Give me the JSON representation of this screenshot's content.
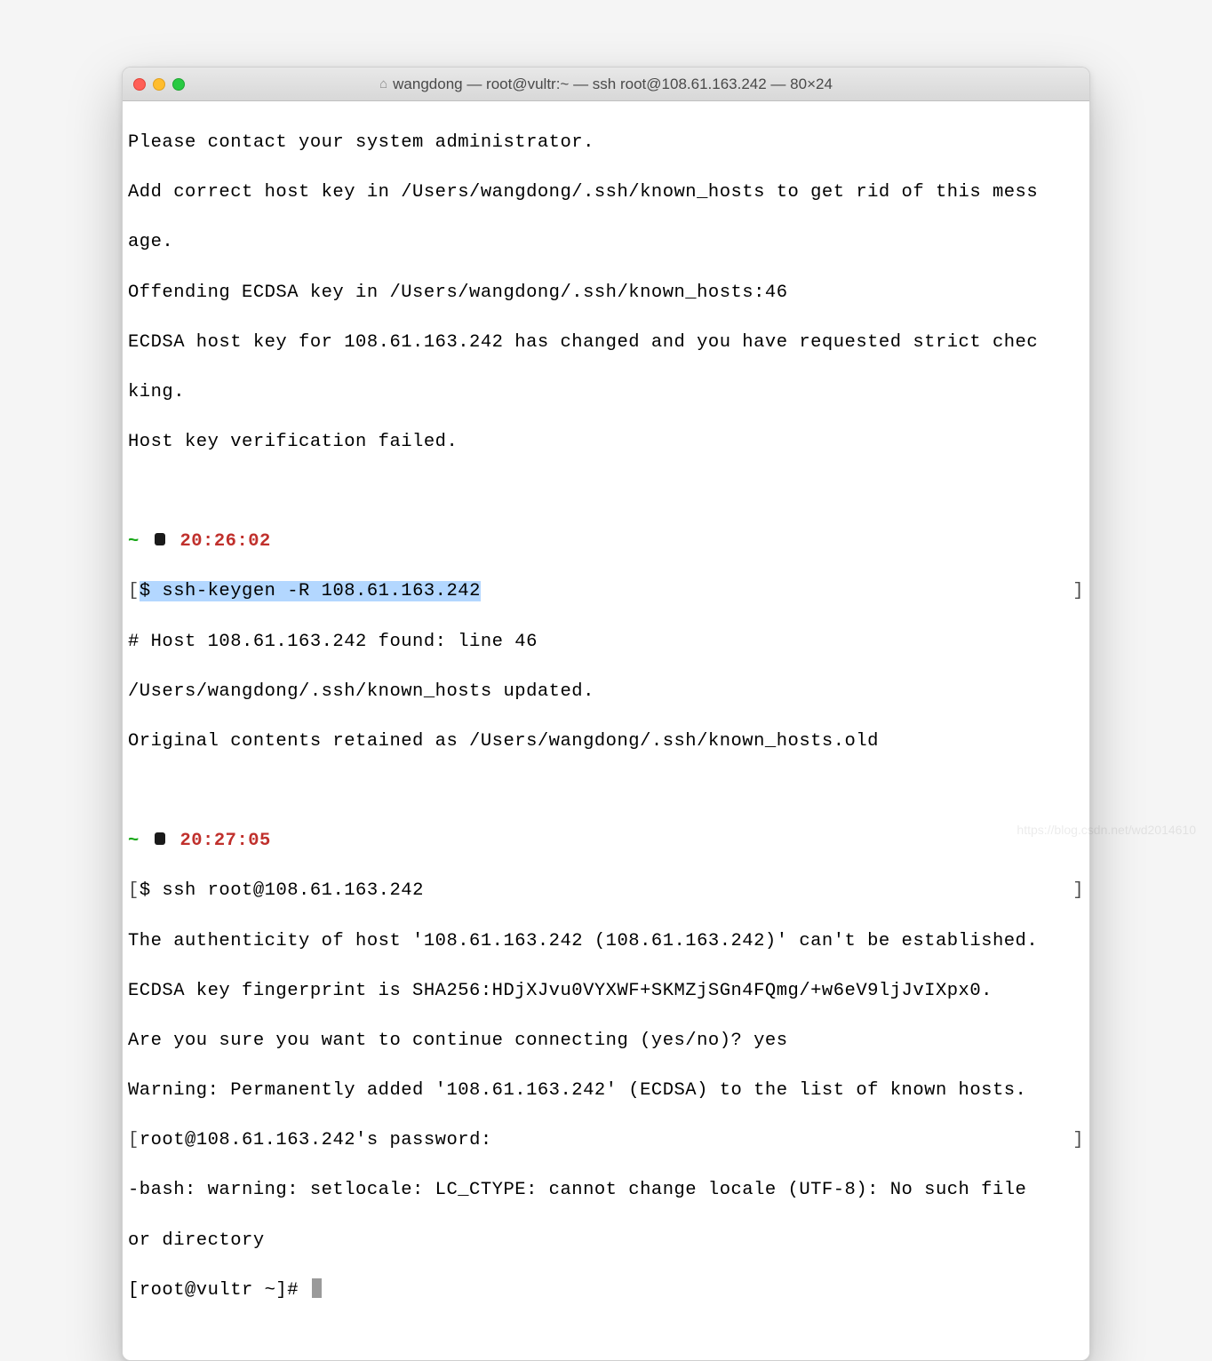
{
  "window": {
    "title": "wangdong — root@vultr:~ — ssh root@108.61.163.242 — 80×24"
  },
  "terminal": {
    "lines": [
      "Please contact your system administrator.",
      "Add correct host key in /Users/wangdong/.ssh/known_hosts to get rid of this mess",
      "age.",
      "Offending ECDSA key in /Users/wangdong/.ssh/known_hosts:46",
      "ECDSA host key for 108.61.163.242 has changed and you have requested strict chec",
      "king.",
      "Host key verification failed."
    ],
    "prompt1": {
      "path": "~",
      "time": "20:26:02",
      "command": "ssh-keygen -R 108.61.163.242"
    },
    "block1": [
      "# Host 108.61.163.242 found: line 46",
      "/Users/wangdong/.ssh/known_hosts updated.",
      "Original contents retained as /Users/wangdong/.ssh/known_hosts.old"
    ],
    "prompt2": {
      "path": "~",
      "time": "20:27:05",
      "command": "ssh root@108.61.163.242"
    },
    "block2": [
      "The authenticity of host '108.61.163.242 (108.61.163.242)' can't be established.",
      "ECDSA key fingerprint is SHA256:HDjXJvu0VYXWF+SKMZjSGn4FQmg/+w6eV9ljJvIXpx0.",
      "Are you sure you want to continue connecting (yes/no)? yes",
      "Warning: Permanently added '108.61.163.242' (ECDSA) to the list of known hosts."
    ],
    "password_prompt": "root@108.61.163.242's password: ",
    "block3": [
      "-bash: warning: setlocale: LC_CTYPE: cannot change locale (UTF-8): No such file ",
      "or directory"
    ],
    "final_prompt": "[root@vultr ~]# "
  },
  "watermark": "https://blog.csdn.net/wd2014610"
}
